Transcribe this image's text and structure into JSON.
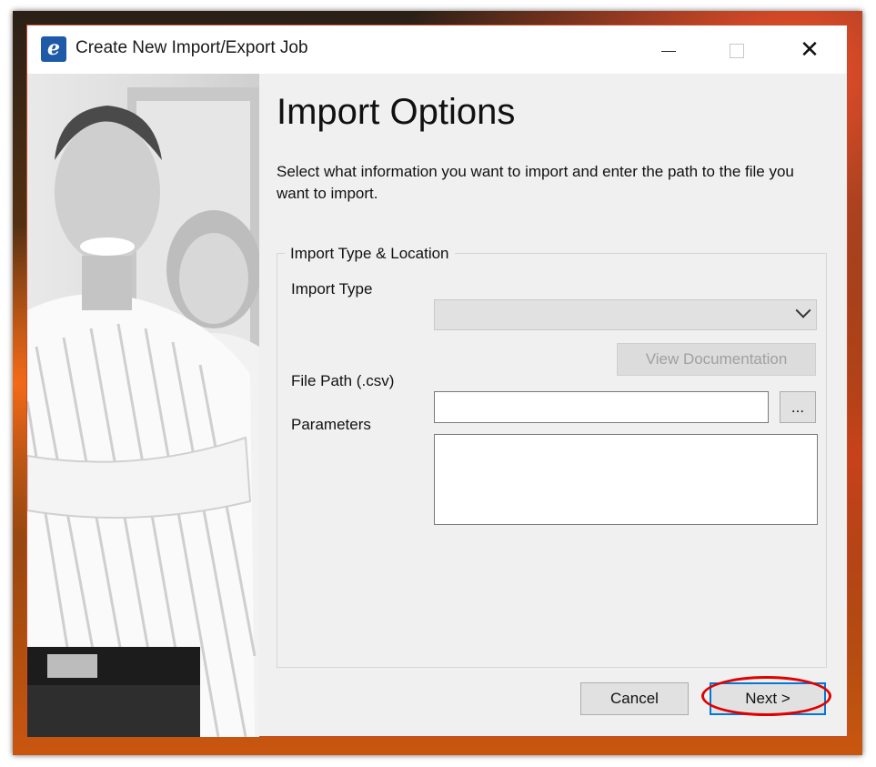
{
  "window": {
    "title": "Create New Import/Export Job",
    "app_icon_letter": "e",
    "controls": {
      "minimize": "—",
      "maximize": "☐",
      "close": "✕"
    }
  },
  "page": {
    "heading": "Import Options",
    "description": "Select what information you want to import and enter the path to the file you want to import."
  },
  "group": {
    "legend": "Import Type & Location",
    "import_type_label": "Import Type",
    "import_type_value": "",
    "view_doc_label": "View Documentation",
    "file_path_label": "File Path (.csv)",
    "file_path_value": "",
    "browse_label": "...",
    "parameters_label": "Parameters",
    "parameters_value": ""
  },
  "footer": {
    "cancel_label": "Cancel",
    "next_label": "Next >"
  },
  "colors": {
    "accent": "#0078d7",
    "annotation": "#e00000",
    "app_icon": "#1e5aa8"
  }
}
